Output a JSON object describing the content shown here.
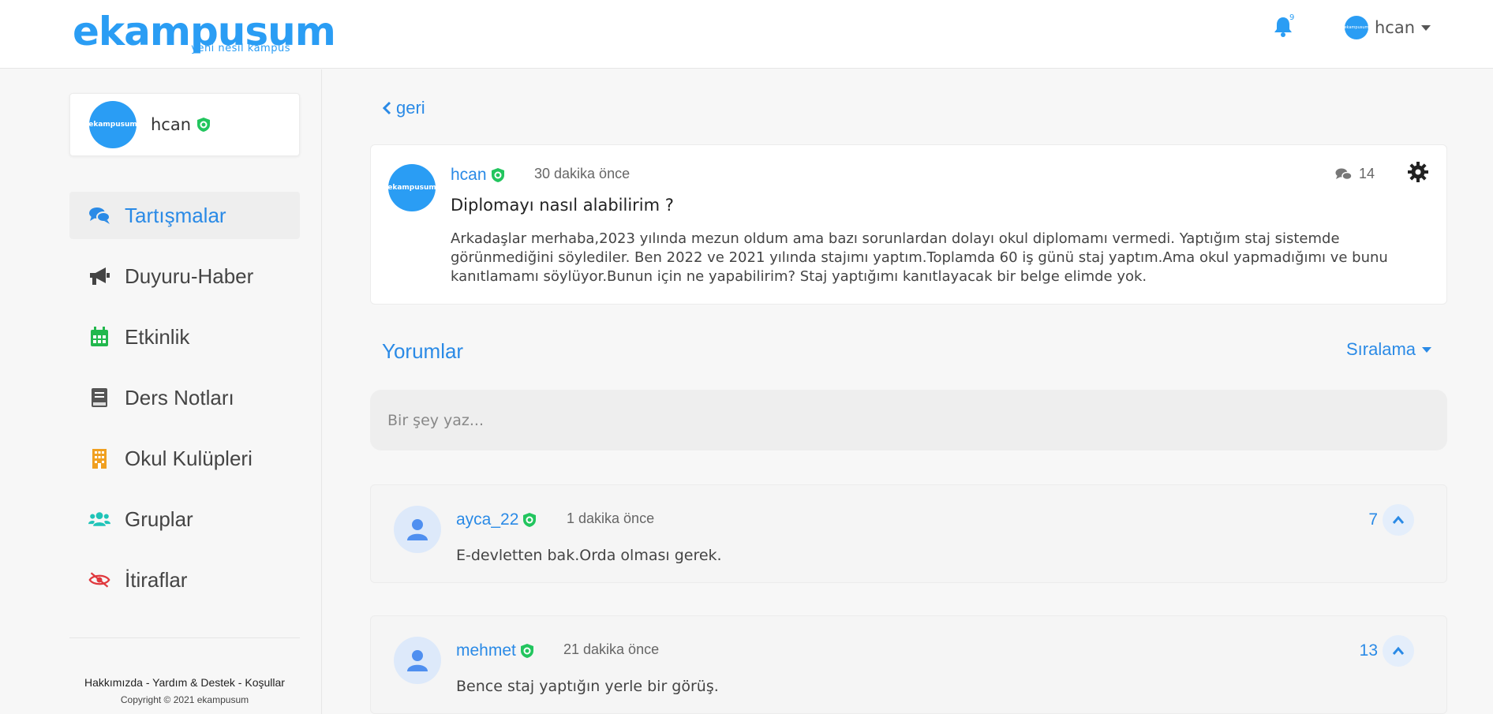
{
  "brand": {
    "name": "ekampusum",
    "tagline": "yeni nesil kampüs",
    "color": "#2a9df4"
  },
  "header": {
    "notification_count": "9",
    "username": "hcan",
    "avatar_text": "ekampusum"
  },
  "sidebar": {
    "profile": {
      "name": "hcan",
      "avatar_text": "ekampusum"
    },
    "items": [
      {
        "label": "Tartışmalar",
        "icon": "comments-icon",
        "active": true
      },
      {
        "label": "Duyuru-Haber",
        "icon": "megaphone-icon"
      },
      {
        "label": "Etkinlik",
        "icon": "calendar-icon"
      },
      {
        "label": "Ders Notları",
        "icon": "book-icon"
      },
      {
        "label": "Okul Kulüpleri",
        "icon": "building-icon"
      },
      {
        "label": "Gruplar",
        "icon": "users-icon"
      },
      {
        "label": "İtiraflar",
        "icon": "eye-slash-icon"
      }
    ],
    "footer": {
      "about": "Hakkımızda",
      "help": "Yardım & Destek",
      "terms": "Koşullar",
      "separator": " - ",
      "copyright": "Copyright © 2021 ekampusum"
    }
  },
  "main": {
    "back_label": "geri",
    "post": {
      "author": "hcan",
      "avatar_text": "ekampusum",
      "time": "30 dakika önce",
      "comment_count": "14",
      "title": "Diplomayı nasıl alabilirim ?",
      "body": "Arkadaşlar merhaba,2023 yılında mezun oldum ama bazı sorunlardan dolayı okul diplomamı vermedi. Yaptığım staj sistemde görünmediğini söylediler. Ben 2022 ve 2021 yılında stajımı yaptım.Toplamda 60 iş günü staj yaptım.Ama okul yapmadığımı ve bunu kanıtlamamı söylüyor.Bunun için ne yapabilirim? Staj yaptığımı kanıtlayacak bir belge elimde yok."
    },
    "comments_title": "Yorumlar",
    "sort_label": "Sıralama",
    "comment_placeholder": "Bir şey yaz...",
    "comments": [
      {
        "author": "ayca_22",
        "time": "1 dakika önce",
        "text": "E-devletten bak.Orda olması gerek.",
        "votes": "7"
      },
      {
        "author": "mehmet",
        "time": "21 dakika önce",
        "text": "Bence staj yaptığın yerle bir görüş.",
        "votes": "13"
      }
    ]
  },
  "colors": {
    "accent": "#2a8ae6",
    "verified": "#22c55e"
  }
}
